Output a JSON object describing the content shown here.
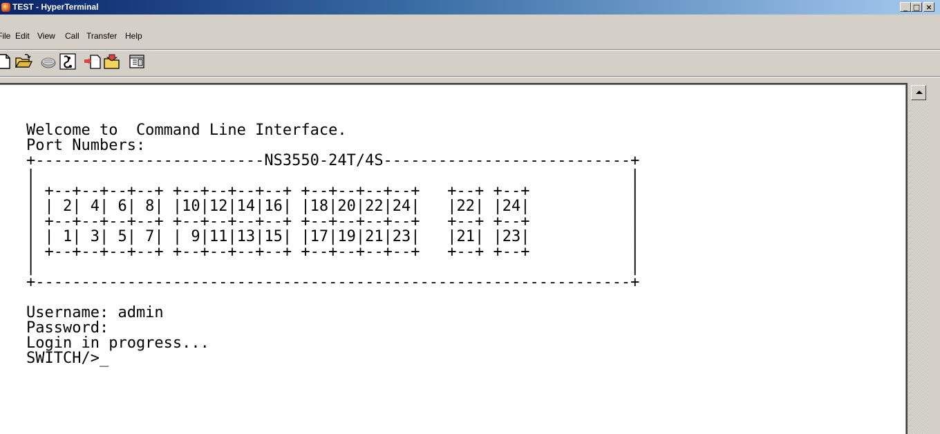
{
  "window": {
    "title": "TEST - HyperTerminal",
    "controls": {
      "minimize": "_",
      "maximize": "□",
      "close": "×"
    }
  },
  "menu": {
    "items": [
      {
        "label": "File"
      },
      {
        "label": "Edit"
      },
      {
        "label": "View"
      },
      {
        "label": "Call"
      },
      {
        "label": "Transfer"
      },
      {
        "label": "Help"
      }
    ]
  },
  "toolbar": {
    "buttons": [
      {
        "icon": "new-icon"
      },
      {
        "icon": "open-icon"
      },
      {
        "icon": "connect-phone-icon"
      },
      {
        "icon": "disconnect-icon"
      },
      {
        "icon": "send-icon"
      },
      {
        "icon": "receive-icon"
      },
      {
        "icon": "properties-icon"
      }
    ]
  },
  "terminal": {
    "lines": [
      "Welcome to  Command Line Interface.",
      "Port Numbers:",
      "+-------------------------NS3550-24T/4S---------------------------+",
      "|                                                                 |",
      "| +--+--+--+--+ +--+--+--+--+ +--+--+--+--+   +--+ +--+           |",
      "| | 2| 4| 6| 8| |10|12|14|16| |18|20|22|24|   |22| |24|           |",
      "| +--+--+--+--+ +--+--+--+--+ +--+--+--+--+   +--+ +--+           |",
      "| | 1| 3| 5| 7| | 9|11|13|15| |17|19|21|23|   |21| |23|           |",
      "| +--+--+--+--+ +--+--+--+--+ +--+--+--+--+   +--+ +--+           |",
      "|                                                                 |",
      "+-----------------------------------------------------------------+",
      "",
      "Username: admin",
      "Password:",
      "Login in progress...",
      "SWITCH/>"
    ],
    "cursor": "_"
  },
  "scrollbar": {
    "up_icon": "scroll-up-arrow-icon"
  }
}
